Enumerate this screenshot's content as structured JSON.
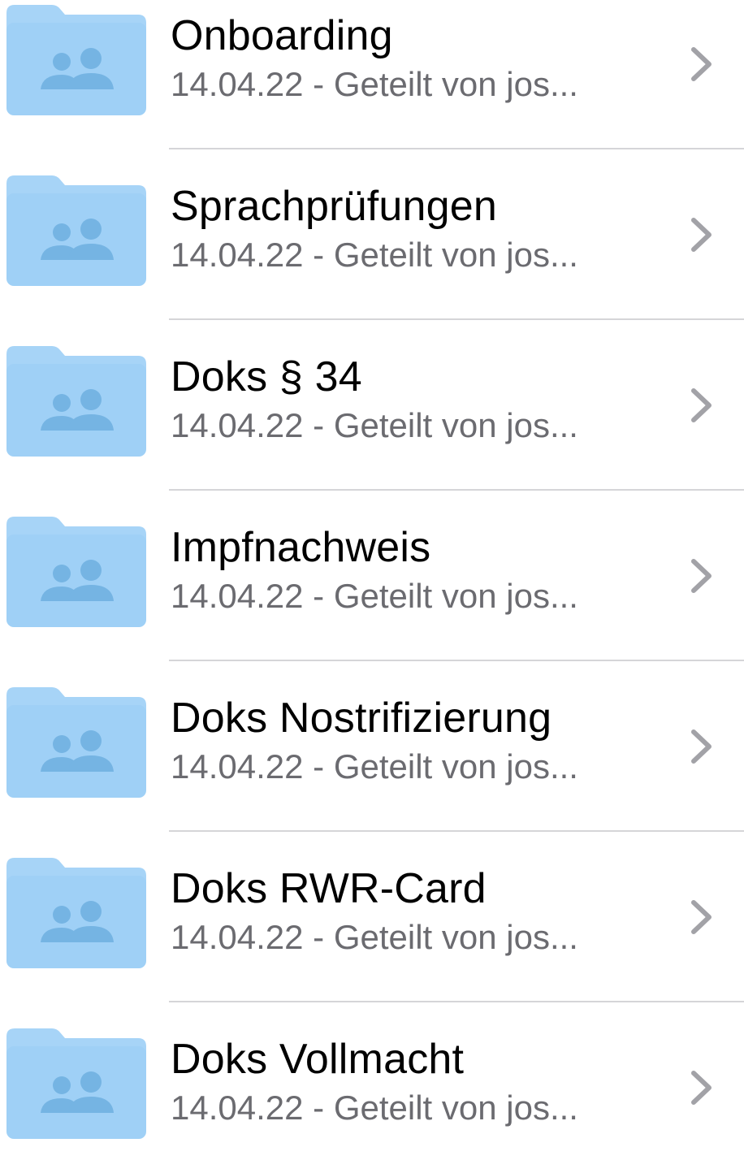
{
  "colors": {
    "folder_back": "#a7d4f7",
    "folder_front": "#9fd0f6",
    "folder_people": "#75b4e3",
    "title": "#000000",
    "subtitle": "#6b6b70",
    "chevron": "#a2a2a7",
    "divider": "#d5d5d8"
  },
  "icons": {
    "folder": "shared-folder-icon",
    "chevron": "chevron-right-icon"
  },
  "items": [
    {
      "title": "Onboarding",
      "subtitle": "14.04.22 - Geteilt von jos..."
    },
    {
      "title": "Sprachprüfungen",
      "subtitle": "14.04.22 - Geteilt von jos..."
    },
    {
      "title": "Doks § 34",
      "subtitle": "14.04.22 - Geteilt von jos..."
    },
    {
      "title": "Impfnachweis",
      "subtitle": "14.04.22 - Geteilt von jos..."
    },
    {
      "title": "Doks Nostrifizierung",
      "subtitle": "14.04.22 - Geteilt von jos..."
    },
    {
      "title": "Doks RWR-Card",
      "subtitle": "14.04.22 - Geteilt von jos..."
    },
    {
      "title": "Doks Vollmacht",
      "subtitle": "14.04.22 - Geteilt von jos..."
    }
  ]
}
